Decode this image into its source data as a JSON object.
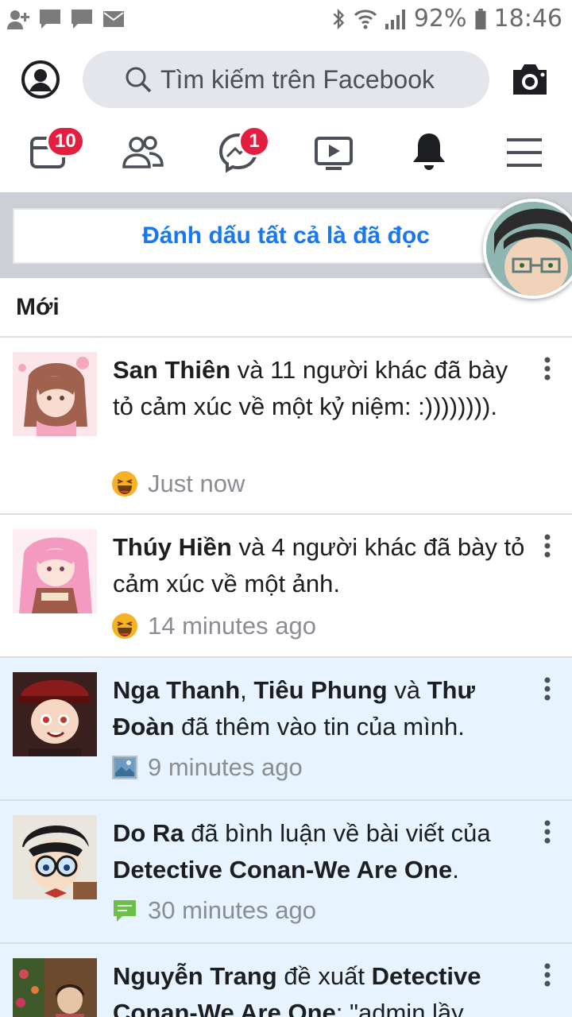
{
  "status_bar": {
    "battery": "92%",
    "time": "18:46",
    "left_icons": [
      "add-friend-icon",
      "chat-bubble-icon",
      "chat-bubble-icon",
      "mail-icon"
    ],
    "right_icons": [
      "bluetooth-icon",
      "wifi-icon",
      "signal-icon",
      "battery-icon"
    ]
  },
  "header": {
    "search_placeholder": "Tìm kiếm trên Facebook"
  },
  "nav": {
    "news_badge": "10",
    "messenger_badge": "1",
    "items": [
      "news-feed",
      "friends",
      "messenger",
      "watch",
      "notifications",
      "menu"
    ]
  },
  "mark_all_read": "Đánh dấu tất cả là đã đọc",
  "section_title": "Mới",
  "notifications": [
    {
      "name1": "San Thiên",
      "text1": " và 11 người khác đã bày tỏ cảm xúc về một kỷ niệm: :)))))))).",
      "time": "Just now",
      "icon": "haha-reaction-icon",
      "unread": false
    },
    {
      "name1": "Thúy Hiền",
      "text1": " và 4 người khác đã bày tỏ cảm xúc về một ảnh.",
      "time": "14 minutes ago",
      "icon": "haha-reaction-icon",
      "unread": false
    },
    {
      "name1": "Nga Thanh",
      "sep1": ", ",
      "name2": "Tiêu Phung",
      "sep2": " và ",
      "name3": "Thư Đoàn",
      "text1": " đã thêm vào tin của mình.",
      "time": "9 minutes ago",
      "icon": "photo-icon",
      "unread": true
    },
    {
      "name1": "Do Ra",
      "text1": " đã bình luận về bài viết của ",
      "name2": "Detective Conan-We Are One",
      "text2": ".",
      "time": "30 minutes ago",
      "icon": "comment-icon",
      "unread": true
    },
    {
      "name1": "Nguyễn Trang",
      "text1": " đề xuất ",
      "name2": "Detective Conan-We Are One",
      "text2": ": \"admin lầy",
      "unread": true
    }
  ],
  "colors": {
    "accent": "#1877f2",
    "badge": "#e41e3f",
    "unread_bg": "#e7f3ff"
  }
}
